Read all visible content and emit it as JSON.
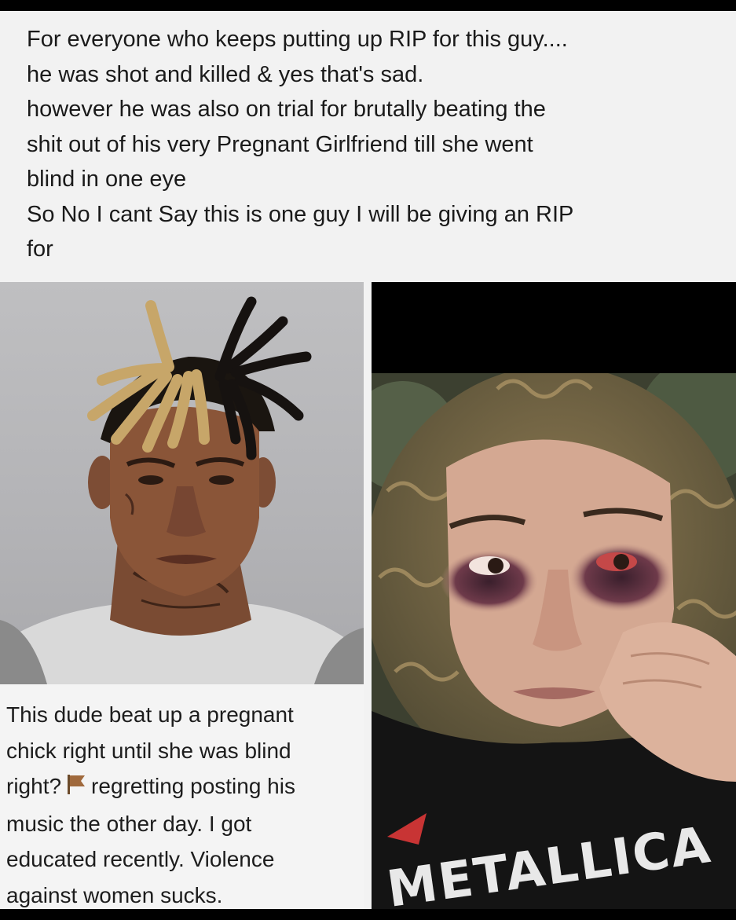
{
  "post": {
    "lines": [
      "For everyone who keeps putting up RIP for this guy....",
      "he was shot and killed & yes that's sad.",
      "however he was also on trial for brutally beating the",
      "shit out of his very Pregnant Girlfriend till she went",
      "blind in one eye",
      "So No I cant Say this is one guy I will be giving an RIP",
      "for"
    ]
  },
  "caption": {
    "line1": "This dude beat up a pregnant",
    "line2": "chick right until she was blind",
    "line3_before": "right?",
    "line3_after": "regretting posting his",
    "line4": "music the other day. I got",
    "line5": "educated recently. Violence",
    "line6": "against women sucks."
  },
  "shirt_text": "METALLICA"
}
